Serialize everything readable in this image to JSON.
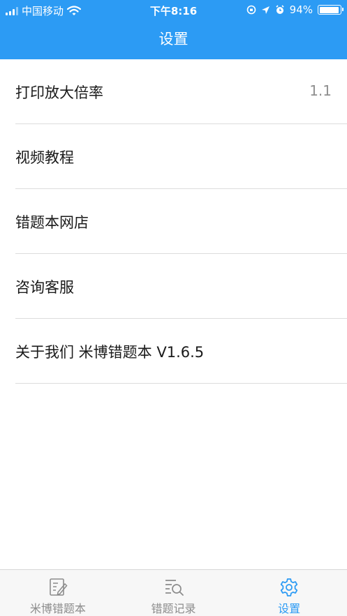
{
  "status_bar": {
    "carrier": "中国移动",
    "time": "下午8:16",
    "battery_percent": "94%",
    "battery_level": 0.94
  },
  "header": {
    "title": "设置"
  },
  "settings": [
    {
      "label": "打印放大倍率",
      "value": "1.1"
    },
    {
      "label": "视频教程"
    },
    {
      "label": "错题本网店"
    },
    {
      "label": "咨询客服"
    },
    {
      "label": "关于我们 米博错题本 V1.6.5"
    }
  ],
  "tabs": [
    {
      "label": "米博错题本",
      "icon": "notebook-icon",
      "active": false
    },
    {
      "label": "错题记录",
      "icon": "list-search-icon",
      "active": false
    },
    {
      "label": "设置",
      "icon": "gear-icon",
      "active": true
    }
  ],
  "colors": {
    "brand": "#2c9bf4",
    "active_tab": "#2c9bf4",
    "inactive_tab": "#8c8c8c"
  }
}
